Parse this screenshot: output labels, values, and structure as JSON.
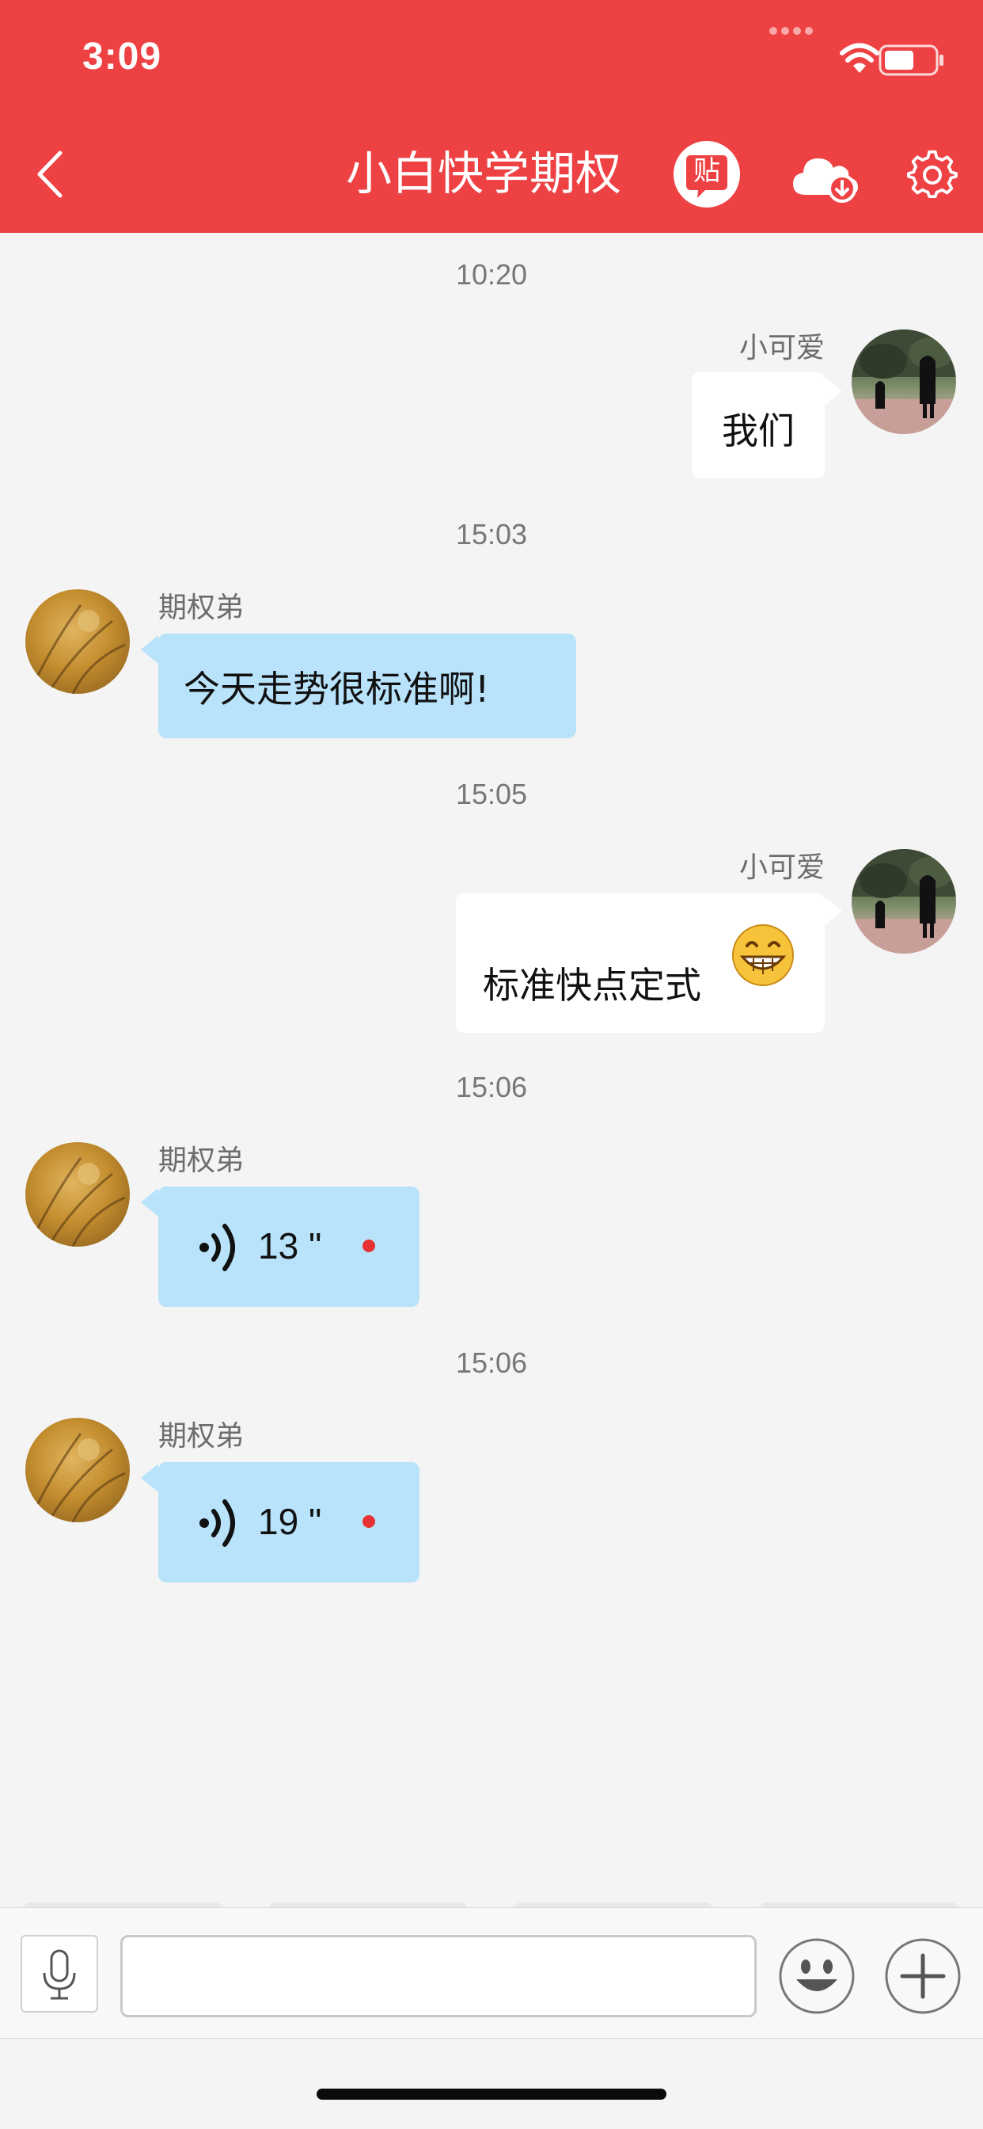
{
  "status_bar": {
    "time": "3:09"
  },
  "header": {
    "title": "小白快学期权",
    "post_icon_label": "贴"
  },
  "messages": [
    {
      "time": "10:20",
      "sender": "小可爱",
      "side": "right",
      "type": "text",
      "text": "我们"
    },
    {
      "time": "15:03",
      "sender": "期权弟",
      "side": "left",
      "type": "text",
      "text": "今天走势很标准啊!"
    },
    {
      "time": "15:05",
      "sender": "小可爱",
      "side": "right",
      "type": "text",
      "text": "标准快点定式",
      "emoji": "grinning-emoji"
    },
    {
      "time": "15:06",
      "sender": "期权弟",
      "side": "left",
      "type": "voice",
      "duration": "13 \"",
      "unread": true
    },
    {
      "time": "15:06",
      "sender": "期权弟",
      "side": "left",
      "type": "voice",
      "duration": "19 \"",
      "unread": true
    }
  ],
  "input_bar": {
    "message_value": "",
    "buttons": [
      "voice-input",
      "emoji",
      "more"
    ]
  },
  "colors": {
    "header": "#ee4144",
    "incoming_bubble": "#b9e3fb",
    "outgoing_bubble": "#ffffff",
    "unread_dot": "#e63232"
  }
}
